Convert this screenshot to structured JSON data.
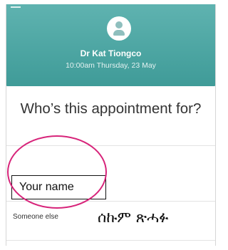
{
  "header": {
    "doctor_name": "Dr Kat Tiongco",
    "appointment_time": "10:00am Thursday, 23 May",
    "accent_color": "#4aa6a3",
    "avatar_icon": "user-icon"
  },
  "main": {
    "question": "Who’s this appointment for?",
    "options": [
      {
        "label": "Your name"
      },
      {
        "label": "Someone else"
      }
    ]
  },
  "annotations": {
    "highlight_color": "#d7247a",
    "handwritten_text": "ሰኩም ጽሓፉ"
  }
}
